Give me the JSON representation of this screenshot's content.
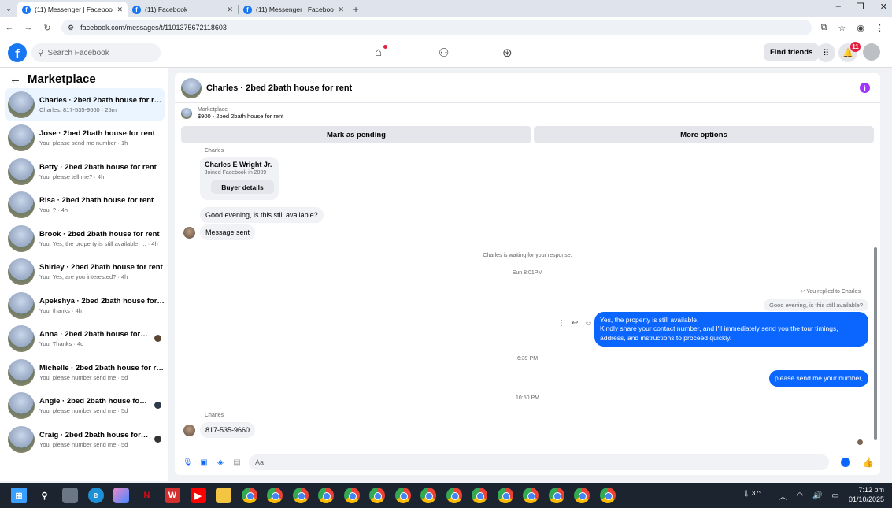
{
  "browser": {
    "tabs": [
      {
        "label": "(11) Messenger | Facebook",
        "active": true
      },
      {
        "label": "(11) Facebook",
        "active": false
      },
      {
        "label": "(11) Messenger | Facebook",
        "active": false
      }
    ],
    "url": "facebook.com/messages/t/1101375672118603"
  },
  "header": {
    "search_placeholder": "Search Facebook",
    "find_friends": "Find friends",
    "notification_count": "11"
  },
  "sidebar": {
    "title": "Marketplace",
    "conversations": [
      {
        "name": "Charles · 2bed 2bath house for rent",
        "preview": "Charles: 817-535-9660 · 25m",
        "active": true
      },
      {
        "name": "Jose · 2bed 2bath house for rent",
        "preview": "You: please send me number · 1h"
      },
      {
        "name": "Betty · 2bed 2bath house for rent",
        "preview": "You: please tell me? · 4h"
      },
      {
        "name": "Risa · 2bed 2bath house for rent",
        "preview": "You: ? · 4h"
      },
      {
        "name": "Brook · 2bed 2bath house for rent",
        "preview": "You: Yes, the property is still available. ... · 4h"
      },
      {
        "name": "Shirley · 2bed 2bath house for rent",
        "preview": "You: Yes, are you interested? · 4h"
      },
      {
        "name": "Apekshya · 2bed 2bath house for r...",
        "preview": "You: thanks · 4h"
      },
      {
        "name": "Anna · 2bed 2bath house for rent",
        "preview": "You: Thanks · 4d"
      },
      {
        "name": "Michelle · 2bed 2bath house for rent",
        "preview": "You: please number send me · 5d"
      },
      {
        "name": "Angie · 2bed 2bath house for rent",
        "preview": "You: please number send me · 5d"
      },
      {
        "name": "Craig · 2bed 2bath house for rent",
        "preview": "You: please number send me · 5d"
      }
    ]
  },
  "chat": {
    "title": "Charles · 2bed 2bath house for rent",
    "marketplace_label": "Marketplace",
    "listing": "$900 - 2bed 2bath house for rent",
    "mark_pending": "Mark as pending",
    "more_options": "More options",
    "sender": "Charles",
    "card_name": "Charles E Wright Jr.",
    "card_joined": "Joined Facebook in 2009",
    "buyer_details": "Buyer details",
    "msg_in_1": "Good evening, is this still available?",
    "msg_in_2": "Message sent",
    "waiting": "Charles is waiting for your response.",
    "time_1": "Sun 8:01PM",
    "replied_to": "You replied to Charles",
    "quoted": "Good evening, is this still available?",
    "msg_out_1_line1": "Yes, the property is still available.",
    "msg_out_1_line2": "Kindly share your contact number, and I'll immediately send you the tour timings,",
    "msg_out_1_line3": "address, and instructions to proceed quickly.",
    "time_2": "6:39 PM",
    "msg_out_2": "please send me your number,",
    "time_3": "10:50 PM",
    "sender_2": "Charles",
    "msg_in_3": "817-535-9660",
    "composer_placeholder": "Aa"
  },
  "taskbar": {
    "weather": "37°",
    "time": "7:12 pm",
    "date": "01/10/2025"
  }
}
